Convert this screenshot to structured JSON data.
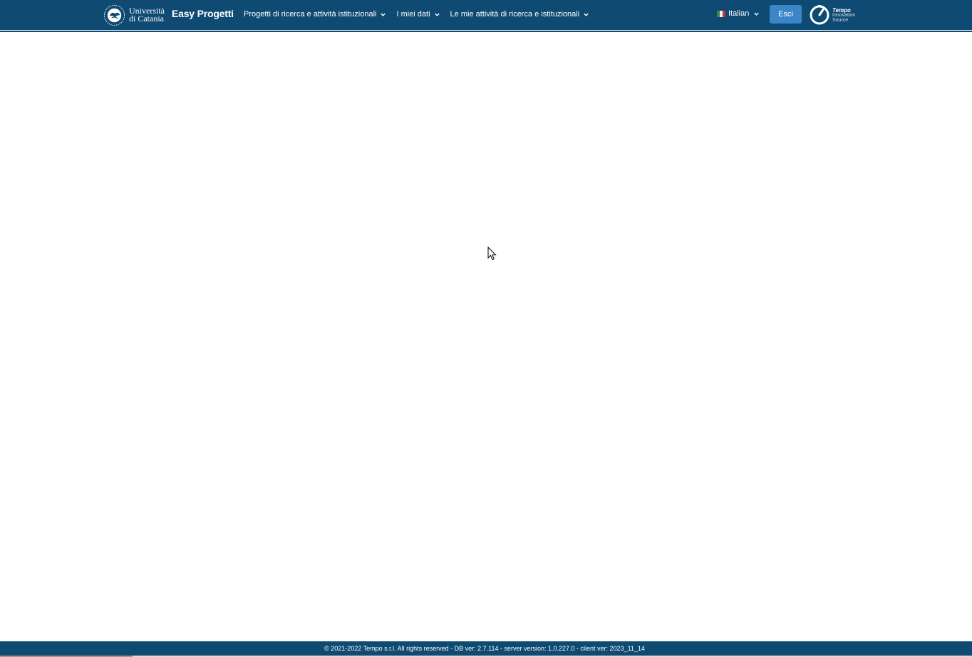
{
  "header": {
    "university_line1": "Università",
    "university_line2": "di Catania",
    "app_title": "Easy Progetti",
    "menu": [
      {
        "label": "Progetti di ricerca e attività istituzionali"
      },
      {
        "label": "I miei dati"
      },
      {
        "label": "Le mie attività di ricerca e istituzionali"
      }
    ],
    "language": "Italian",
    "logout_label": "Esci",
    "vendor_line1": "Tempo",
    "vendor_line2": "Innovation",
    "vendor_line3": "Source"
  },
  "footer": {
    "text": "© 2021-2022 Tempo s.r.l. All rights reserved - DB ver: 2.7.114 - server version: 1.0.227.0 - client ver: 2023_11_14"
  },
  "colors": {
    "navbar": "#0e4a72",
    "accent_button": "#3a86c8",
    "background": "#ffffff"
  },
  "icons": [
    "university-seal-icon",
    "chevron-down-icon",
    "italy-flag-icon",
    "tempo-logo-icon",
    "mouse-cursor-icon"
  ]
}
